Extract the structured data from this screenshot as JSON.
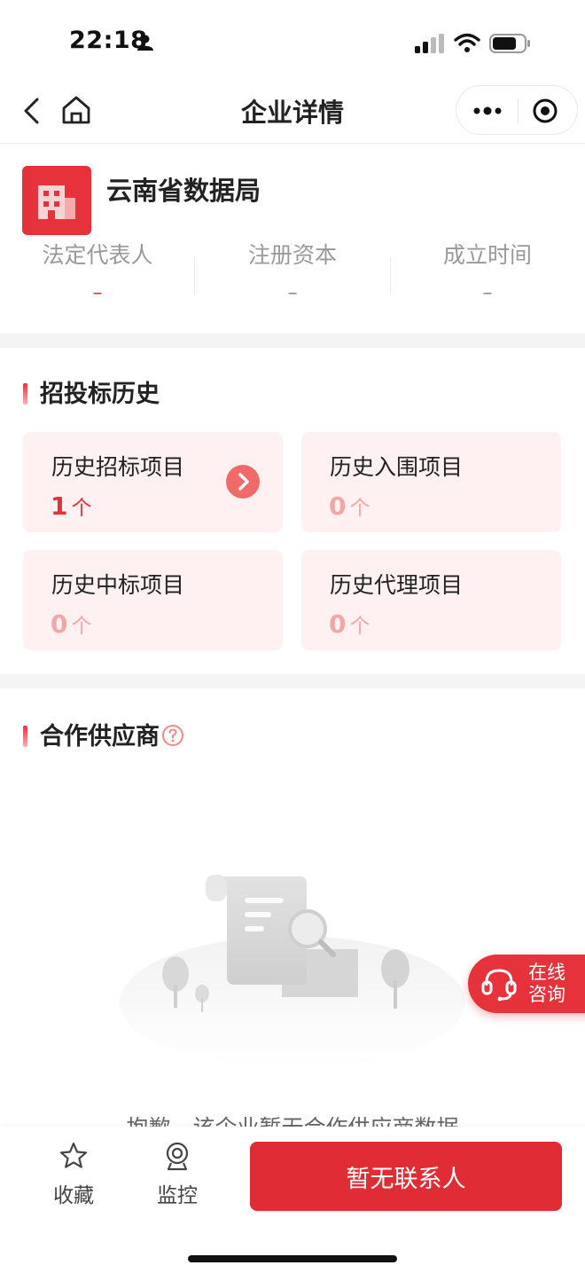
{
  "status_bar": {
    "time": "22:18"
  },
  "nav": {
    "title": "企业详情"
  },
  "company": {
    "name": "云南省数据局",
    "fields": [
      {
        "label": "法定代表人",
        "value": "–"
      },
      {
        "label": "注册资本",
        "value": "–"
      },
      {
        "label": "成立时间",
        "value": "–"
      }
    ]
  },
  "bid_history": {
    "title": "招投标历史",
    "cards": [
      {
        "label": "历史招标项目",
        "count": "1",
        "unit": "个"
      },
      {
        "label": "历史入围项目",
        "count": "0",
        "unit": "个"
      },
      {
        "label": "历史中标项目",
        "count": "0",
        "unit": "个"
      },
      {
        "label": "历史代理项目",
        "count": "0",
        "unit": "个"
      }
    ]
  },
  "suppliers": {
    "title": "合作供应商",
    "empty_text": "抱歉，该企业暂无合作供应商数据"
  },
  "consult": {
    "line1": "在线",
    "line2": "咨询"
  },
  "bottom": {
    "favorite_label": "收藏",
    "monitor_label": "监控",
    "contact_label": "暂无联系人"
  },
  "colors": {
    "brand_red": "#e6323b",
    "card_bg": "#fff1f1",
    "muted_red": "#f3a6a6"
  }
}
